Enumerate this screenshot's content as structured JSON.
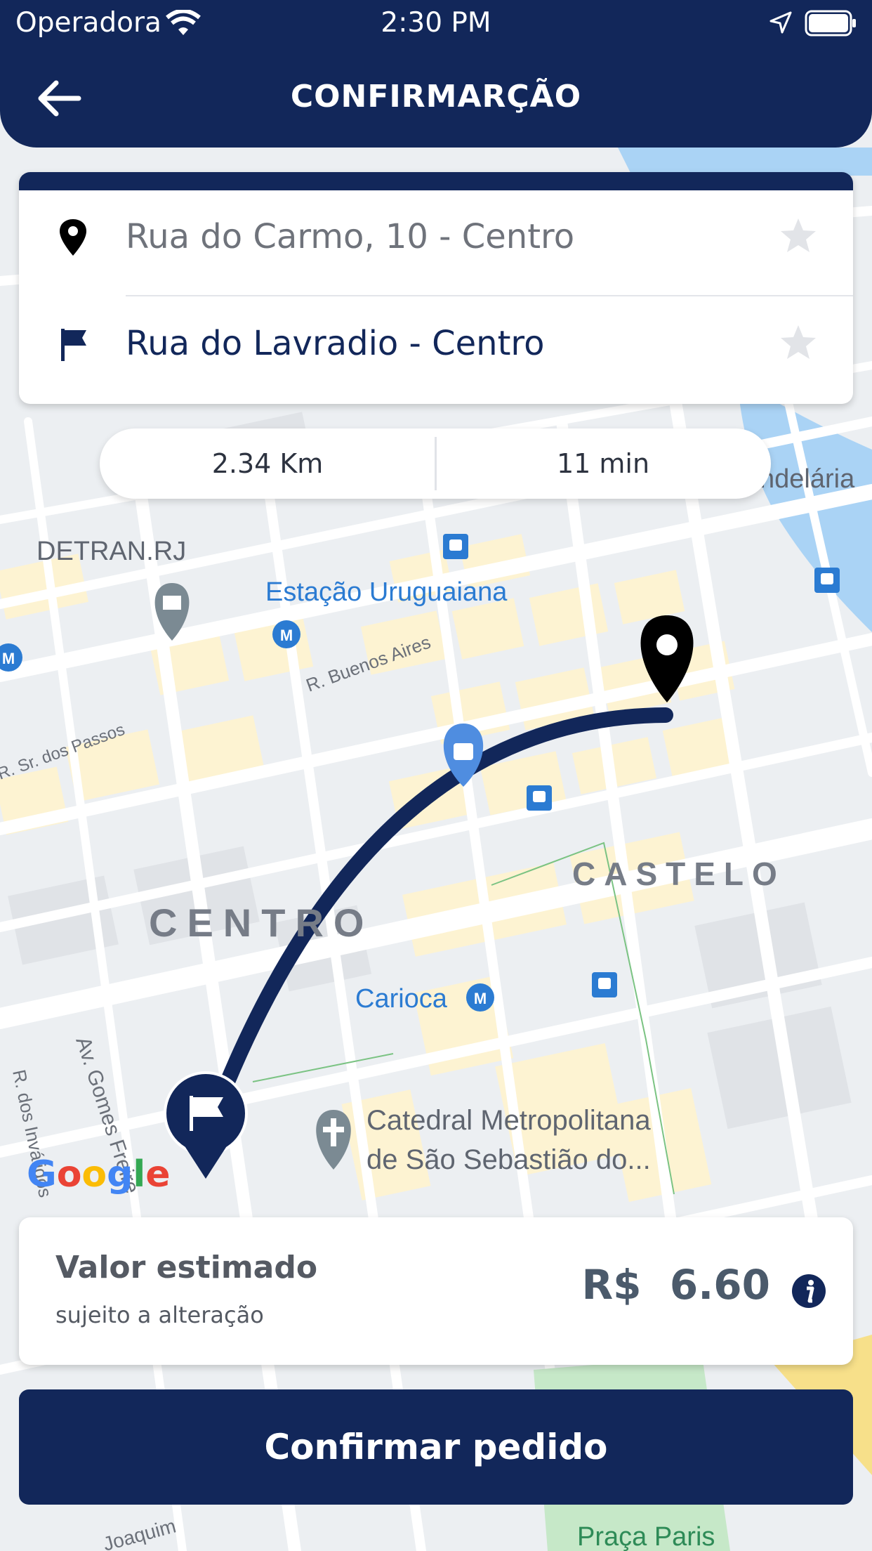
{
  "status_bar": {
    "carrier": "Operadora",
    "time": "2:30 PM"
  },
  "header": {
    "title": "CONFIRMARÇÃO"
  },
  "route": {
    "origin": "Rua do Carmo, 10 - Centro",
    "destination": "Rua do Lavradio - Centro"
  },
  "metrics": {
    "distance": "2.34 Km",
    "duration": "11 min"
  },
  "map_labels": {
    "detran": "DETRAN.RJ",
    "estacao": "Estação Uruguaiana",
    "buenos_aires": "R. Buenos Aires",
    "sr_passos": "R. Sr. dos Passos",
    "castelo": "CASTELO",
    "centro": "CENTRO",
    "carioca": "Carioca",
    "catedral_1": "Catedral Metropolitana",
    "catedral_2": "de São Sebastião do...",
    "gomes_freire": "Av. Gomes Freire",
    "invalidos": "R. dos Inválidos",
    "candelaria": "ndelária",
    "praca_paris": "Praça Paris",
    "joaquim": "Joaquim",
    "google": "Google"
  },
  "price": {
    "label": "Valor estimado",
    "subtitle": "sujeito a alteração",
    "value": "R$  6.60"
  },
  "confirm_label": "Confirmar pedido",
  "colors": {
    "primary": "#12275a",
    "map_bg": "#eceff2",
    "block": "#fdf3d2"
  },
  "icons": [
    "back-arrow-icon",
    "map-pin-icon",
    "flag-icon",
    "star-icon",
    "info-icon",
    "wifi-icon",
    "location-arrow-icon",
    "battery-icon"
  ]
}
